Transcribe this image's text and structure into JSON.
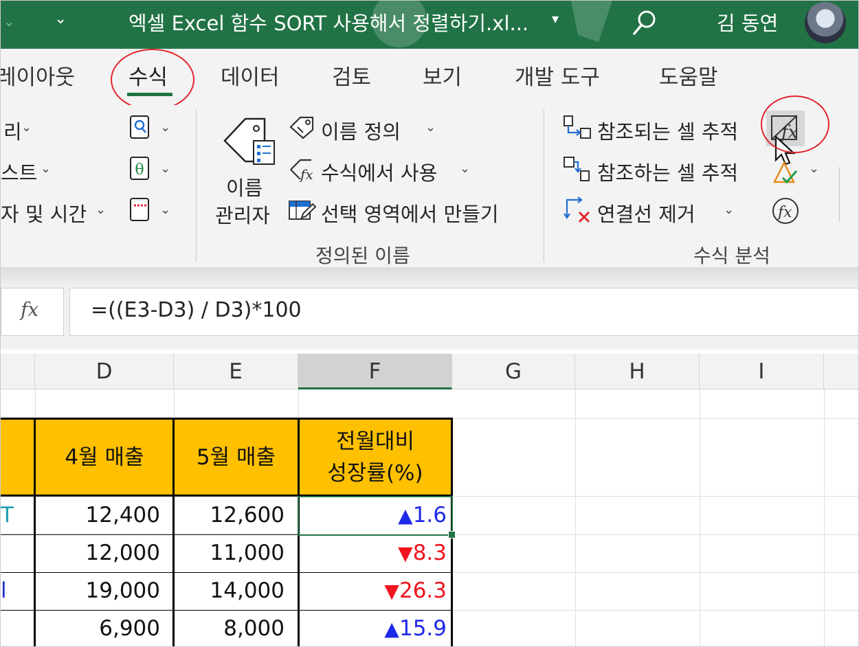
{
  "title_bar": {
    "qat_dropdown": "⌄",
    "doc_title": "엑셀 Excel 함수 SORT 사용해서 정렬하기.xl...",
    "title_caret": "▾",
    "user_name": "김 동연"
  },
  "tabs": [
    {
      "label": "레이아웃"
    },
    {
      "label": "수식",
      "active": true
    },
    {
      "label": "데이터"
    },
    {
      "label": "검토"
    },
    {
      "label": "보기"
    },
    {
      "label": "개발 도구"
    },
    {
      "label": "도움말"
    }
  ],
  "ribbon": {
    "library_items": [
      "리",
      "스트",
      "자 및 시간"
    ],
    "defined_names": {
      "name_manager": [
        "이름",
        "관리자"
      ],
      "define_name": "이름 정의",
      "use_in_formula": "수식에서 사용",
      "create_from_selection": "선택 영역에서 만들기",
      "group_label": "정의된 이름"
    },
    "formula_auditing": {
      "trace_precedents": "참조되는 셀 추적",
      "trace_dependents": "참조하는 셀 추적",
      "remove_arrows": "연결선 제거",
      "group_label": "수식 분석"
    }
  },
  "formula_bar": {
    "fx": "fx",
    "formula": "=((E3-D3) / D3)*100"
  },
  "columns": [
    "D",
    "E",
    "F",
    "G",
    "H",
    "I"
  ],
  "table": {
    "headers": [
      {
        "lines": [
          "4월 매출"
        ]
      },
      {
        "lines": [
          "5월 매출"
        ]
      },
      {
        "lines": [
          "전월대비",
          "성장률(%)"
        ]
      }
    ],
    "rows": [
      {
        "april": "12,400",
        "may": "12,600",
        "arrow": "▲",
        "growth": "1.6",
        "direction": "up"
      },
      {
        "april": "12,000",
        "may": "11,000",
        "arrow": "▼",
        "growth": "8.3",
        "direction": "down"
      },
      {
        "april": "19,000",
        "may": "14,000",
        "arrow": "▼",
        "growth": "26.3",
        "direction": "down"
      },
      {
        "april": "6,900",
        "may": "8,000",
        "arrow": "▲",
        "growth": "15.9",
        "direction": "up"
      }
    ],
    "left_edge_fragments": [
      "T",
      "",
      "l",
      ""
    ]
  },
  "colors": {
    "excel_green": "#217346",
    "header_fill": "#ffc000",
    "up": "#1d28e8",
    "down": "#f0141e",
    "annotation_red": "#e0262c"
  }
}
